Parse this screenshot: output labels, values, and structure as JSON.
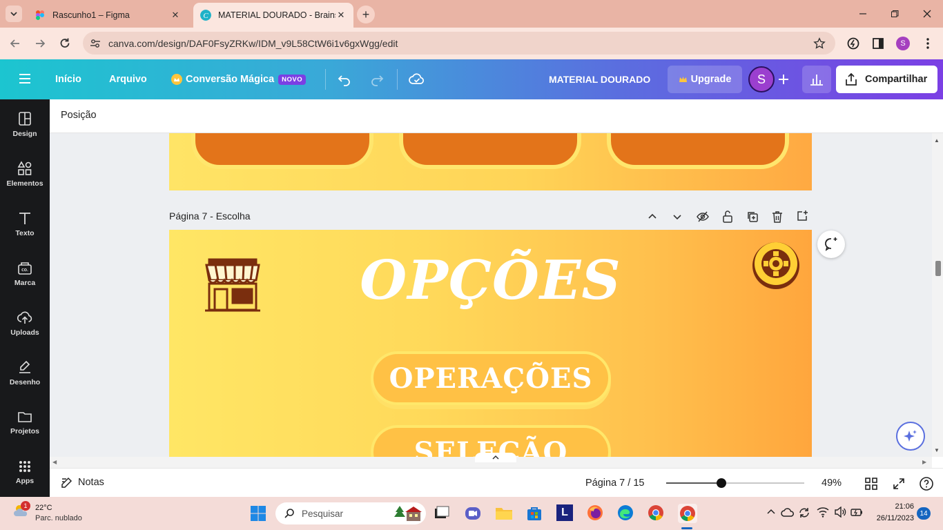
{
  "browser": {
    "tabs": [
      {
        "title": "Rascunho1 – Figma",
        "active": false
      },
      {
        "title": "MATERIAL DOURADO - Brainstorm",
        "active": true
      }
    ],
    "url": "canva.com/design/DAF0FsyZRKw/IDM_v9L58CtW6i1v6gxWgg/edit",
    "profile_initial": "S"
  },
  "canva_header": {
    "home_label": "Início",
    "file_label": "Arquivo",
    "magic_label": "Conversão Mágica",
    "new_badge": "NOVO",
    "design_title": "MATERIAL DOURADO",
    "upgrade_label": "Upgrade",
    "avatar_initial": "S",
    "share_label": "Compartilhar"
  },
  "sidebar": {
    "items": [
      {
        "label": "Design",
        "icon": "layout-icon"
      },
      {
        "label": "Elementos",
        "icon": "shapes-icon"
      },
      {
        "label": "Texto",
        "icon": "text-icon"
      },
      {
        "label": "Marca",
        "icon": "brand-icon"
      },
      {
        "label": "Uploads",
        "icon": "cloud-upload-icon"
      },
      {
        "label": "Desenho",
        "icon": "draw-icon"
      },
      {
        "label": "Projetos",
        "icon": "folder-icon"
      },
      {
        "label": "Apps",
        "icon": "apps-grid-icon"
      }
    ]
  },
  "toolbar": {
    "position_label": "Posição"
  },
  "page": {
    "label": "Página 7 - Escolha",
    "title": "OPÇÕES",
    "options": [
      "OPERAÇÕES",
      "SELEÇÃO"
    ]
  },
  "footer": {
    "notes_label": "Notas",
    "page_indicator": "Página 7 / 15",
    "zoom": "49%",
    "zoom_fraction": 0.4
  },
  "taskbar": {
    "weather_temp": "22°C",
    "weather_desc": "Parc. nublado",
    "weather_badge": "1",
    "search_placeholder": "Pesquisar",
    "time": "21:06",
    "date": "26/11/2023",
    "notification_count": "14"
  },
  "colors": {
    "canva_gradient_start": "#1cc5d0",
    "canva_gradient_end": "#7b3fe4",
    "page_yellow": "#ffe665",
    "page_orange": "#ffa63d",
    "brown_icon": "#7a2e0e",
    "pill_fill": "#ffc145"
  }
}
